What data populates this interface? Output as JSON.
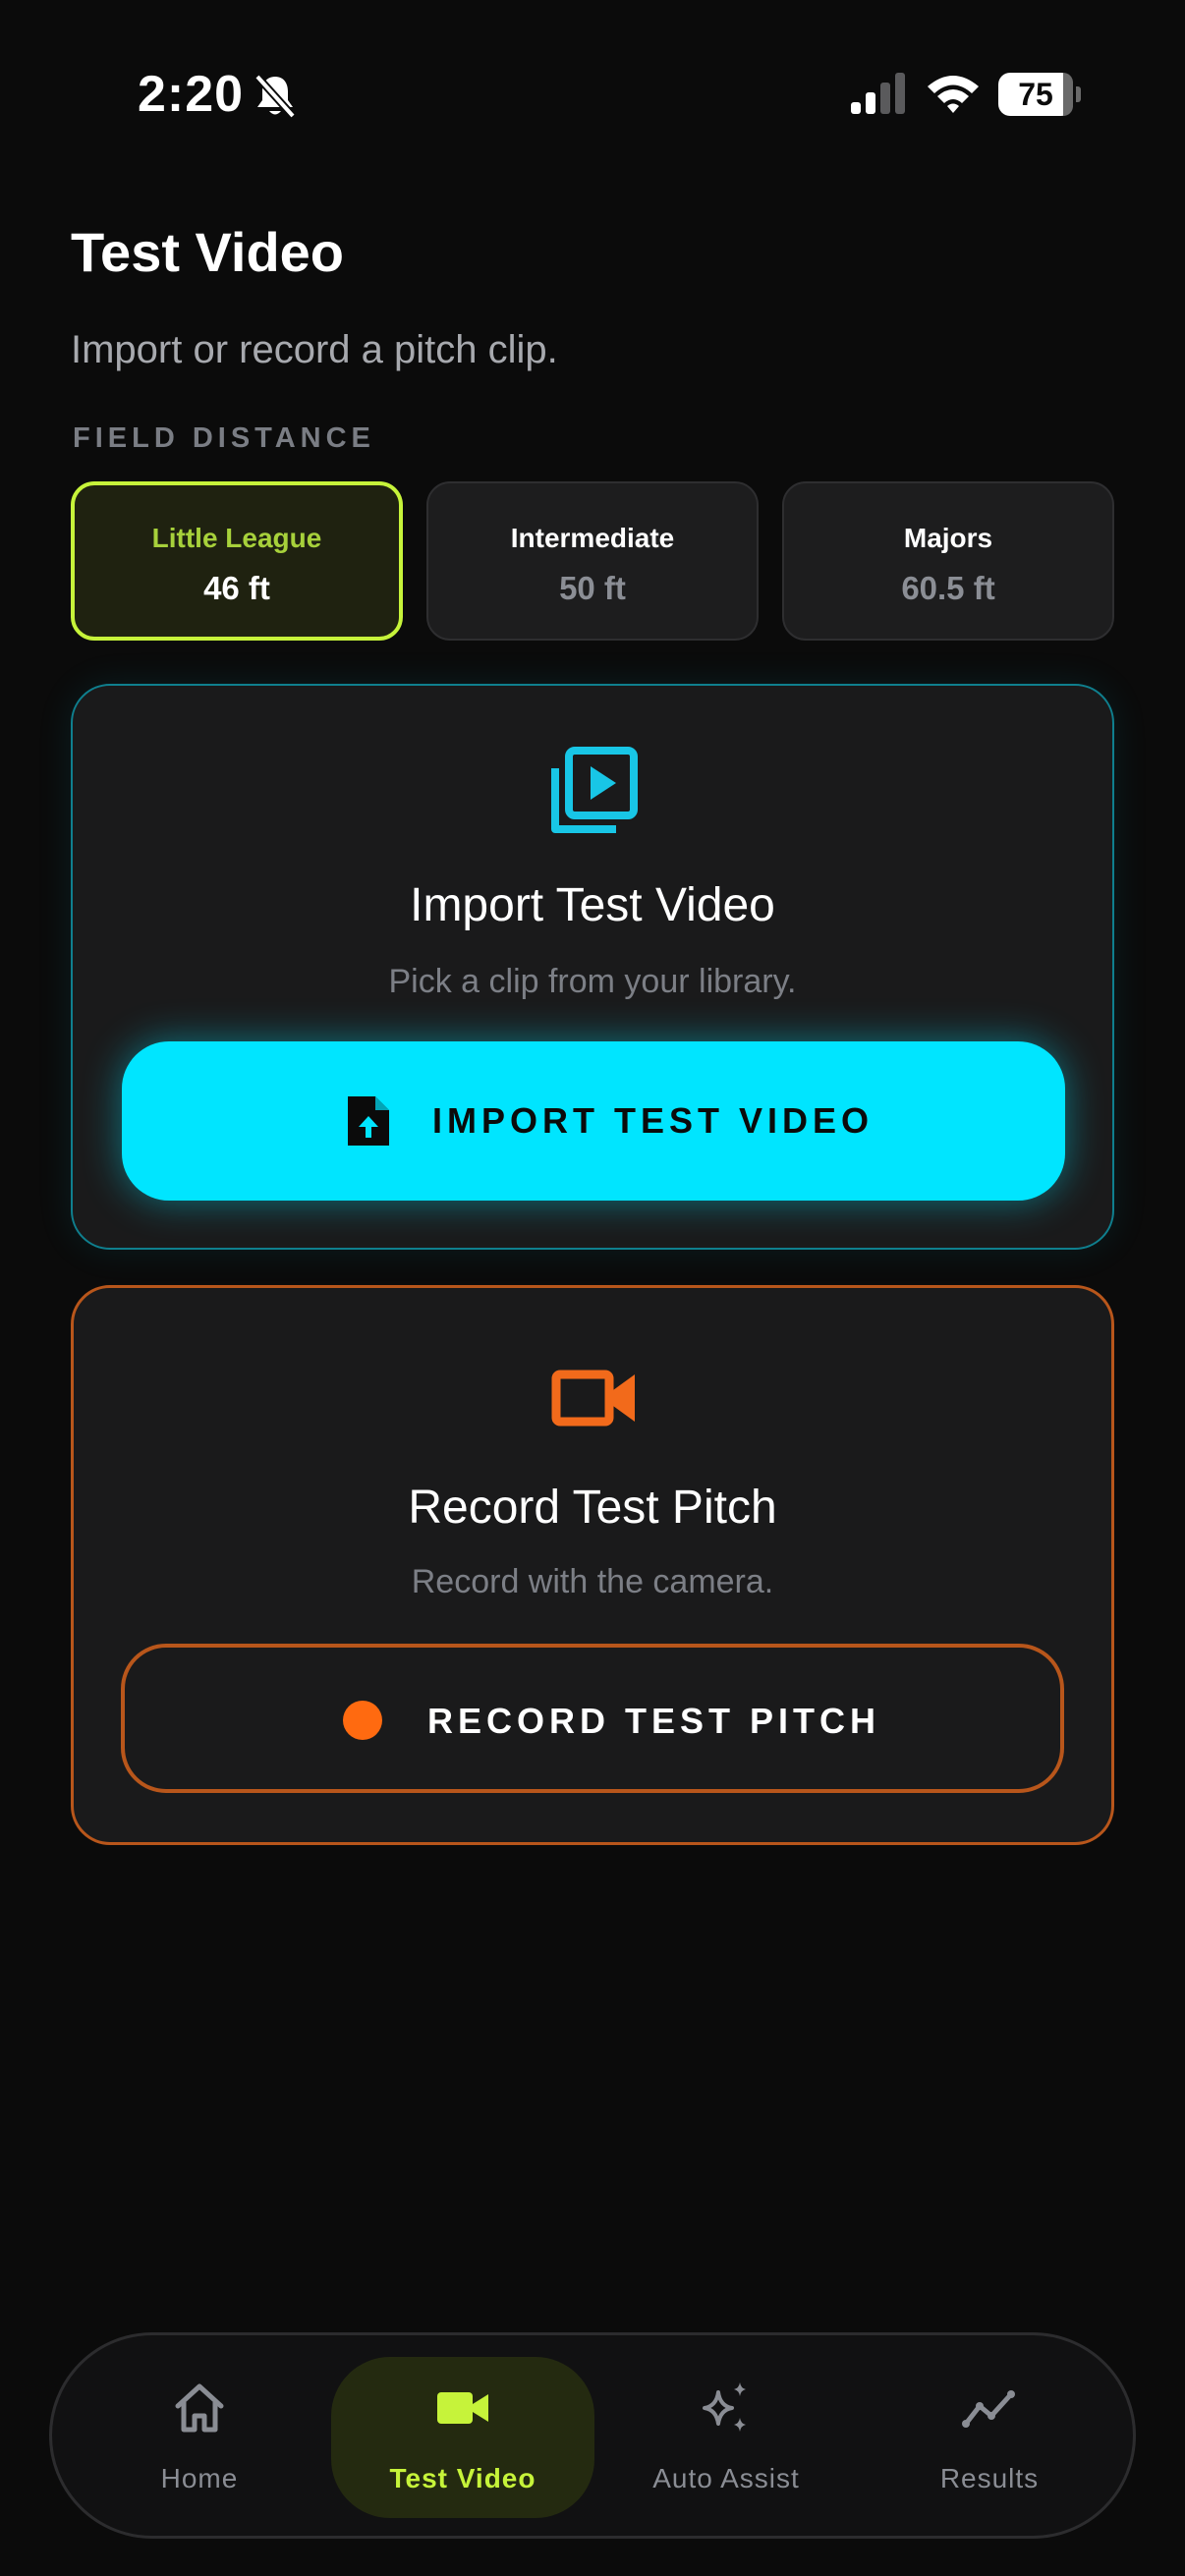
{
  "status_bar": {
    "time": "2:20",
    "battery": "75"
  },
  "header": {
    "title": "Test Video",
    "subtitle": "Import or record a pitch clip."
  },
  "field_distance": {
    "label": "FIELD DISTANCE",
    "options": [
      {
        "name": "Little League",
        "value": "46 ft",
        "selected": true
      },
      {
        "name": "Intermediate",
        "value": "50 ft",
        "selected": false
      },
      {
        "name": "Majors",
        "value": "60.5 ft",
        "selected": false
      }
    ]
  },
  "import_card": {
    "icon": "video-library-icon",
    "title": "Import Test Video",
    "description": "Pick a clip from your library.",
    "button_label": "IMPORT TEST VIDEO",
    "button_icon": "file-upload-icon"
  },
  "record_card": {
    "icon": "video-camera-icon",
    "title": "Record Test Pitch",
    "description": "Record with the camera.",
    "button_label": "RECORD TEST PITCH",
    "button_icon": "record-dot-icon"
  },
  "bottom_nav": {
    "items": [
      {
        "label": "Home",
        "icon": "home-icon",
        "active": false
      },
      {
        "label": "Test Video",
        "icon": "video-camera-icon",
        "active": true
      },
      {
        "label": "Auto Assist",
        "icon": "sparkles-icon",
        "active": false
      },
      {
        "label": "Results",
        "icon": "trend-chart-icon",
        "active": false
      }
    ]
  },
  "colors": {
    "background": "#0b0b0b",
    "accent_lime": "#c6f33a",
    "accent_cyan": "#00e5ff",
    "accent_orange": "#ff6a10"
  }
}
